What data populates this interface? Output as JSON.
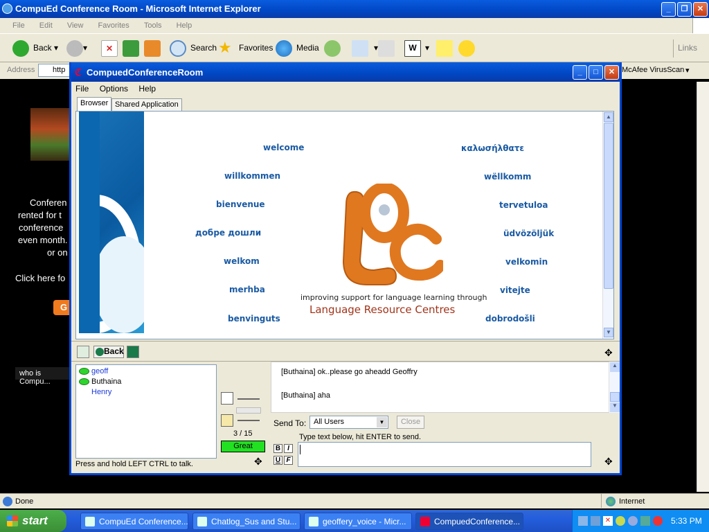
{
  "ie": {
    "title": "CompuEd Conference Room - Microsoft Internet Explorer",
    "menu": [
      "File",
      "Edit",
      "View",
      "Favorites",
      "Tools",
      "Help"
    ],
    "toolbar": {
      "back": "Back",
      "search": "Search",
      "favorites": "Favorites",
      "media": "Media",
      "links": "Links"
    },
    "address_label": "Address",
    "address_value": "http",
    "mcafee": "McAfee VirusScan",
    "status_text": "Done",
    "zone": "Internet"
  },
  "background_page": {
    "lines": [
      "Conferen",
      "rented for t",
      "conference",
      "even month.",
      "or on",
      "Click here fo"
    ],
    "button": "G",
    "who": "who is Compu..."
  },
  "conf": {
    "title": "CompuedConferenceRoom",
    "menu": [
      "File",
      "Options",
      "Help"
    ],
    "tabs": [
      "Browser",
      "Shared Application"
    ],
    "welcome_left": [
      "welcome",
      "willkommen",
      "bienvenue",
      "добре дошли",
      "welkom",
      "merhba",
      "benvinguts"
    ],
    "welcome_right": [
      "καλωσήλθατε",
      "wëllkomm",
      "tervetuloa",
      "üdvözöljük",
      "velkomin",
      "vitejte",
      "dobrodošli"
    ],
    "logo_text": "LRC",
    "tagline": "improving support for language learning through",
    "org_name": "Language Resource Centres",
    "nav_back": "Back",
    "users": [
      {
        "name": "geoff",
        "color": "#1a3ad8",
        "speaking": true
      },
      {
        "name": "Buthaina",
        "color": "#000000",
        "speaking": true
      },
      {
        "name": "Henry",
        "color": "#1a3ad8",
        "speaking": false
      }
    ],
    "counter": "3 / 15",
    "quality": "Great",
    "talk_hint": "Press and hold LEFT CTRL to talk.",
    "chat": [
      "[Buthaina] ok..please go aheadd Geoffry",
      "[Buthaina] aha"
    ],
    "send_to_label": "Send To:",
    "send_to_value": "All Users",
    "close_button": "Close",
    "input_hint": "Type text below, hit ENTER to send.",
    "fmt": [
      "B",
      "I",
      "U",
      "F"
    ]
  },
  "taskbar": {
    "start": "start",
    "tasks": [
      "CompuEd Conference...",
      "Chatlog_Sus and Stu...",
      "geoffery_voice - Micr...",
      "CompuedConference..."
    ],
    "clock": "5:33 PM"
  },
  "colors": {
    "accent": "#0047d4",
    "word_blue": "#1a5aa3",
    "lrc_orange": "#e07820",
    "quality_green": "#22e022"
  }
}
